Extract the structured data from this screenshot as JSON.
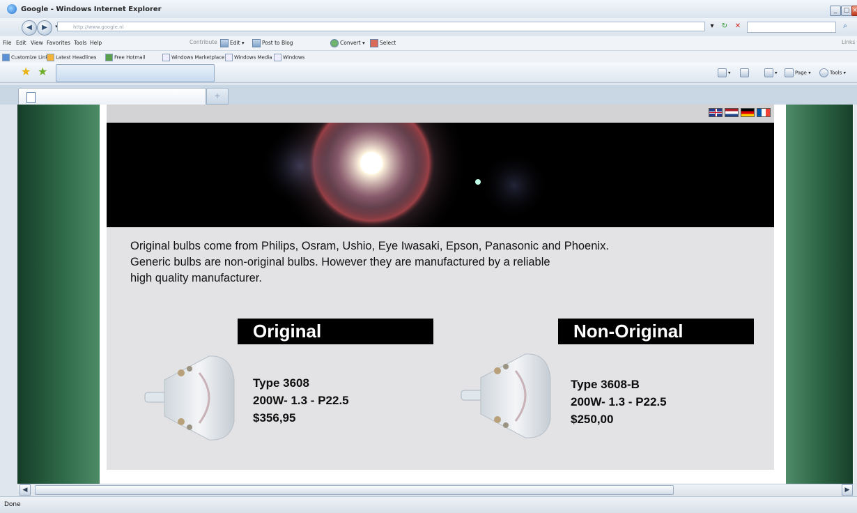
{
  "window": {
    "title": "Google - Windows Internet Explorer"
  },
  "address_bar": {
    "url": "http://www.google.nl"
  },
  "menu": [
    "File",
    "Edit",
    "View",
    "Favorites",
    "Tools",
    "Help"
  ],
  "toolbar": {
    "contribute": "Contribute",
    "edit": "Edit",
    "post_to_blog": "Post to Blog",
    "convert": "Convert",
    "select": "Select",
    "links": "Links"
  },
  "links_bar": [
    "Customize Links",
    "Latest Headlines",
    "Free Hotmail",
    "Windows Marketplace",
    "Windows Media",
    "Windows"
  ],
  "command_bar": {
    "page": "Page",
    "tools": "Tools"
  },
  "page": {
    "intro_lines": [
      "Original bulbs come from Philips, Osram, Ushio, Eye Iwasaki, Epson, Panasonic and Phoenix.",
      "Generic bulbs are non-original bulbs. However they are manufactured by a reliable",
      "high quality manufacturer."
    ],
    "products": [
      {
        "heading": "Original",
        "type": "Type 3608",
        "spec": "200W- 1.3 - P22.5",
        "price": "$356,95"
      },
      {
        "heading": "Non-Original",
        "type": "Type 3608-B",
        "spec": "200W- 1.3 - P22.5",
        "price": "$250,00"
      }
    ],
    "languages": [
      "English",
      "Dutch",
      "German",
      "French"
    ]
  },
  "status": {
    "text": "Done"
  }
}
